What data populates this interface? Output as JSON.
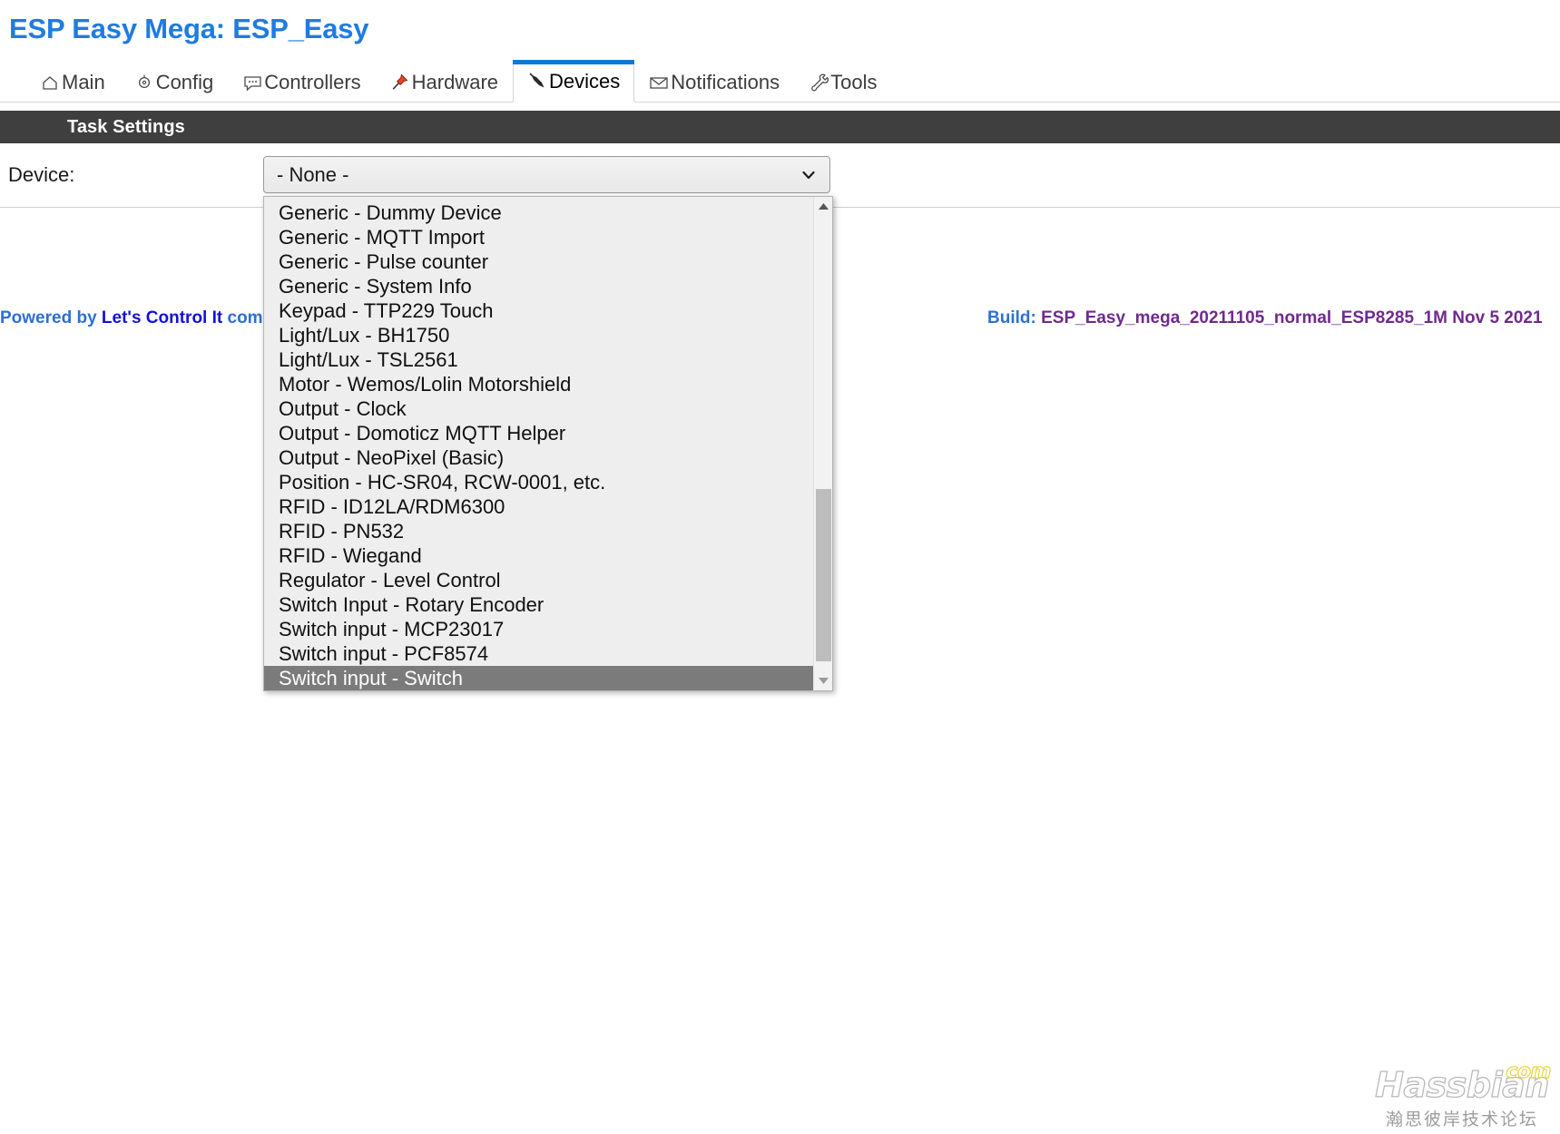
{
  "header": {
    "title": "ESP Easy Mega: ESP_Easy",
    "title_color": "#1e7ce0"
  },
  "tabs": [
    {
      "label": "Main",
      "icon": "home-icon",
      "active": false
    },
    {
      "label": "Config",
      "icon": "gear-icon",
      "active": false
    },
    {
      "label": "Controllers",
      "icon": "speech-bubble-icon",
      "active": false
    },
    {
      "label": "Hardware",
      "icon": "pushpin-icon",
      "active": false
    },
    {
      "label": "Devices",
      "icon": "plug-icon",
      "active": true
    },
    {
      "label": "Notifications",
      "icon": "envelope-icon",
      "active": false
    },
    {
      "label": "Tools",
      "icon": "wrench-icon",
      "active": false
    }
  ],
  "section": {
    "title": "Task Settings",
    "bar_color": "#3f3f3f"
  },
  "form": {
    "device_label": "Device:",
    "device_selected": "- None -",
    "chevron_icon": "chevron-down-icon"
  },
  "dropdown": {
    "open": true,
    "selected_index": 19,
    "highlight_color": "#7b7b7b",
    "options": [
      "Generic - Dummy Device",
      "Generic - MQTT Import",
      "Generic - Pulse counter",
      "Generic - System Info",
      "Keypad - TTP229 Touch",
      "Light/Lux - BH1750",
      "Light/Lux - TSL2561",
      "Motor - Wemos/Lolin Motorshield",
      "Output - Clock",
      "Output - Domoticz MQTT Helper",
      "Output - NeoPixel (Basic)",
      "Position - HC-SR04, RCW-0001, etc.",
      "RFID - ID12LA/RDM6300",
      "RFID - PN532",
      "RFID - Wiegand",
      "Regulator - Level Control",
      "Switch Input - Rotary Encoder",
      "Switch input - MCP23017",
      "Switch input - PCF8574",
      "Switch input - Switch"
    ],
    "scrollbar": {
      "up_arrow_icon": "triangle-up-icon",
      "down_arrow_icon": "triangle-down-icon"
    }
  },
  "footer": {
    "powered_prefix": "Powered by ",
    "powered_link": "Let's Control It",
    "powered_suffix": " commu",
    "build_label": "Build:",
    "build_value": "ESP_Easy_mega_20211105_normal_ESP8285_1M Nov 5 2021"
  },
  "watermark": {
    "name": "Hassbian",
    "tld": "com",
    "subtitle": "瀚思彼岸技术论坛"
  }
}
